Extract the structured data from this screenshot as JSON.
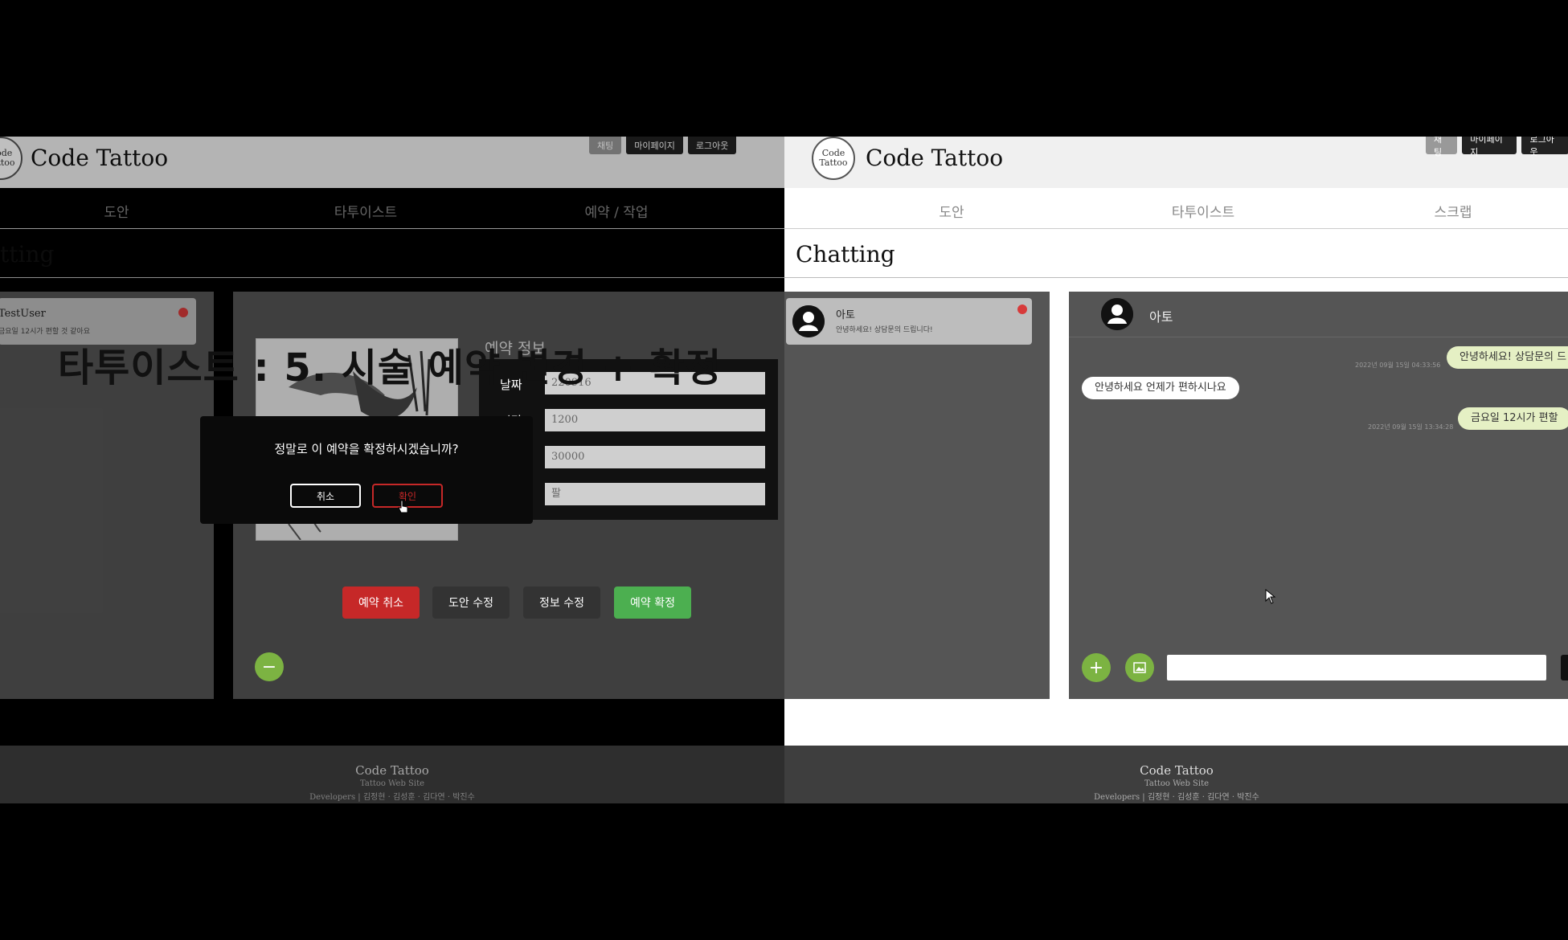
{
  "brand": "Code Tattoo",
  "logo_text": "Code\nTattoo",
  "top_buttons": [
    "채팅",
    "마이페이지",
    "로그아웃"
  ],
  "left": {
    "nav": [
      "도안",
      "타투이스트",
      "예약 / 작업"
    ],
    "section_title": "tting",
    "overlay_title": "타투이스트 : 5. 시술 예약 변경 + 확정",
    "chat_user": "TestUser",
    "chat_preview": "금요일 12시가 편할 것 같아요",
    "info_title": "예약 정보",
    "fields": [
      {
        "label": "날짜",
        "value": "220916"
      },
      {
        "label": "시간",
        "value": "1200"
      },
      {
        "label": "",
        "value": "30000"
      },
      {
        "label": "",
        "value": "팔"
      }
    ],
    "modal": {
      "message": "정말로 이 예약을 확정하시겠습니까?",
      "cancel": "취소",
      "confirm": "확인"
    },
    "actions": [
      "예약 취소",
      "도안 수정",
      "정보 수정",
      "예약 확정"
    ],
    "minus": "−"
  },
  "right": {
    "nav": [
      "도안",
      "타투이스트",
      "스크랩"
    ],
    "section_title": "Chatting",
    "chat_user": "아토",
    "chat_preview": "안녕하세요! 상담문의 드립니다!",
    "header_user": "아토",
    "messages": [
      {
        "text": "안녕하세요! 상담문의 드",
        "time": "2022년 09월 15일 04:33:56",
        "side": "right"
      },
      {
        "text": "안녕하세요 언제가 편하시나요",
        "time": "",
        "side": "left"
      },
      {
        "text": "금요일 12시가 편할",
        "time": "2022년 09월 15일 13:34:28",
        "side": "right"
      }
    ],
    "plus": "+",
    "input_value": ""
  },
  "footer": {
    "title": "Code Tattoo",
    "subtitle": "Tattoo Web Site",
    "developers": "Developers | 김정현 · 김성훈 · 김다연 · 박진수"
  },
  "colors": {
    "green": "#7cb342",
    "red": "#c62828",
    "panel": "#555555",
    "bubble_green": "#e5f0c4"
  }
}
